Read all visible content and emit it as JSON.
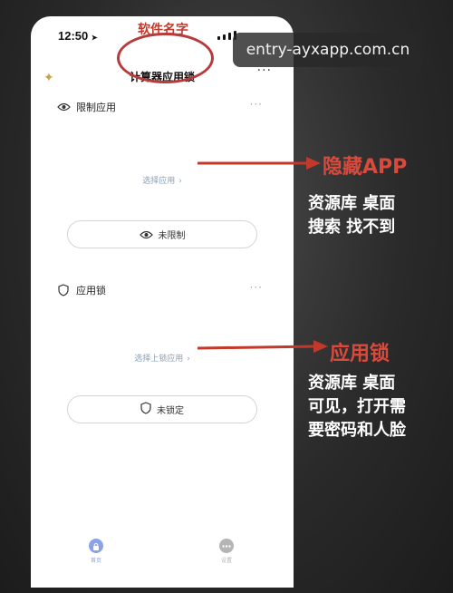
{
  "status_bar": {
    "time": "12:50",
    "location_arrow": "➤"
  },
  "header": {
    "title": "计算器应用锁",
    "more": "···",
    "sparkle": "✦"
  },
  "restrict_section": {
    "title": "限制应用",
    "more": "···",
    "select_link": "选择应用",
    "status": "未限制"
  },
  "lock_section": {
    "title": "应用锁",
    "more": "···",
    "select_link": "选择上锁应用",
    "status": "未锁定"
  },
  "tabbar": {
    "items": [
      {
        "label": "首页",
        "icon": "lock-icon",
        "color": "#8ba3e6"
      },
      {
        "label": "设置",
        "icon": "more-dots-icon",
        "color": "#b5b5b5"
      }
    ]
  },
  "annotations": {
    "top_label": "软件名字",
    "watermark": "entry-ayxapp.com.cn",
    "hide_app_label": "隐藏APP",
    "hide_app_desc": [
      "资源库 桌面",
      "搜索 找不到"
    ],
    "app_lock_label": "应用锁",
    "app_lock_desc": [
      "资源库 桌面",
      "可见，打开需",
      "要密码和人脸"
    ]
  },
  "colors": {
    "accent_red": "#c0392b",
    "link": "#8aa0b6",
    "tab_active": "#8ba3e6"
  },
  "chevron": "›"
}
